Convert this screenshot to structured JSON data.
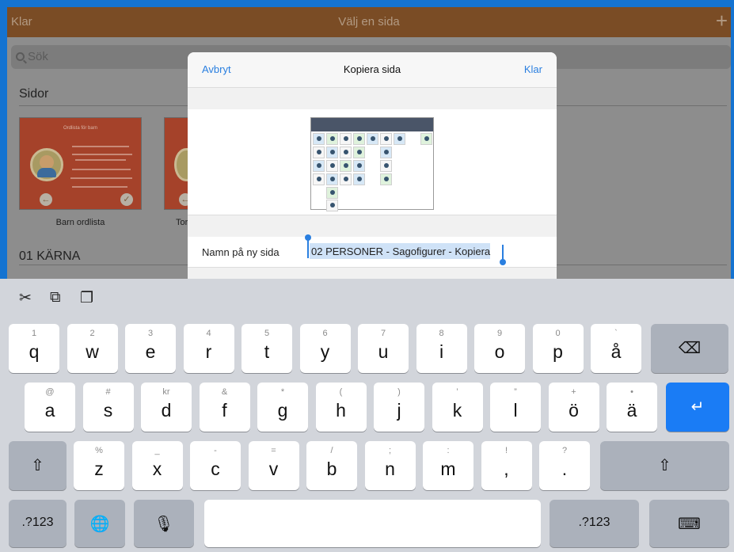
{
  "app": {
    "done_label": "Klar",
    "title": "Välj en sida",
    "add_label": "+",
    "search_placeholder": "Sök",
    "sections": [
      {
        "title": "Sidor"
      },
      {
        "title": "01 KÄRNA"
      }
    ],
    "pages": [
      {
        "label": "Barn ordlista",
        "thumb_title": "Ordlista för barn"
      },
      {
        "label": "Tor"
      }
    ]
  },
  "modal": {
    "cancel_label": "Avbryt",
    "title": "Kopiera sida",
    "done_label": "Klar",
    "name_label": "Namn på ny sida",
    "name_value": "02 PERSONER - Sagofigurer - Kopiera"
  },
  "keyboard": {
    "toolbar": [
      {
        "name": "cut-icon",
        "glyph": "✂"
      },
      {
        "name": "copy-icon",
        "glyph": "⧉"
      },
      {
        "name": "paste-icon",
        "glyph": "❐"
      }
    ],
    "row1": [
      {
        "hint": "1",
        "char": "q"
      },
      {
        "hint": "2",
        "char": "w"
      },
      {
        "hint": "3",
        "char": "e"
      },
      {
        "hint": "4",
        "char": "r"
      },
      {
        "hint": "5",
        "char": "t"
      },
      {
        "hint": "6",
        "char": "y"
      },
      {
        "hint": "7",
        "char": "u"
      },
      {
        "hint": "8",
        "char": "i"
      },
      {
        "hint": "9",
        "char": "o"
      },
      {
        "hint": "0",
        "char": "p"
      },
      {
        "hint": "`",
        "char": "å"
      }
    ],
    "row2": [
      {
        "hint": "@",
        "char": "a"
      },
      {
        "hint": "#",
        "char": "s"
      },
      {
        "hint": "kr",
        "char": "d"
      },
      {
        "hint": "&",
        "char": "f"
      },
      {
        "hint": "*",
        "char": "g"
      },
      {
        "hint": "(",
        "char": "h"
      },
      {
        "hint": ")",
        "char": "j"
      },
      {
        "hint": "’",
        "char": "k"
      },
      {
        "hint": "”",
        "char": "l"
      },
      {
        "hint": "+",
        "char": "ö"
      },
      {
        "hint": "•",
        "char": "ä"
      }
    ],
    "row3": [
      {
        "hint": "%",
        "char": "z"
      },
      {
        "hint": "_",
        "char": "x"
      },
      {
        "hint": "-",
        "char": "c"
      },
      {
        "hint": "=",
        "char": "v"
      },
      {
        "hint": "/",
        "char": "b"
      },
      {
        "hint": ";",
        "char": "n"
      },
      {
        "hint": ":",
        "char": "m"
      },
      {
        "hint": "!",
        "char": ","
      },
      {
        "hint": "?",
        "char": "."
      }
    ],
    "numbers_label": ".?123",
    "shift_glyph": "⇧",
    "delete_glyph": "⌫",
    "return_glyph": "↵",
    "globe_glyph": "🌐",
    "mic_glyph": "🎙",
    "hide_glyph": "⌨",
    "return_color": "#1a7cf5"
  },
  "colors": {
    "accent": "#2a7fe0",
    "nav_brown": "#7a4c25",
    "page_red": "#a5422a"
  }
}
